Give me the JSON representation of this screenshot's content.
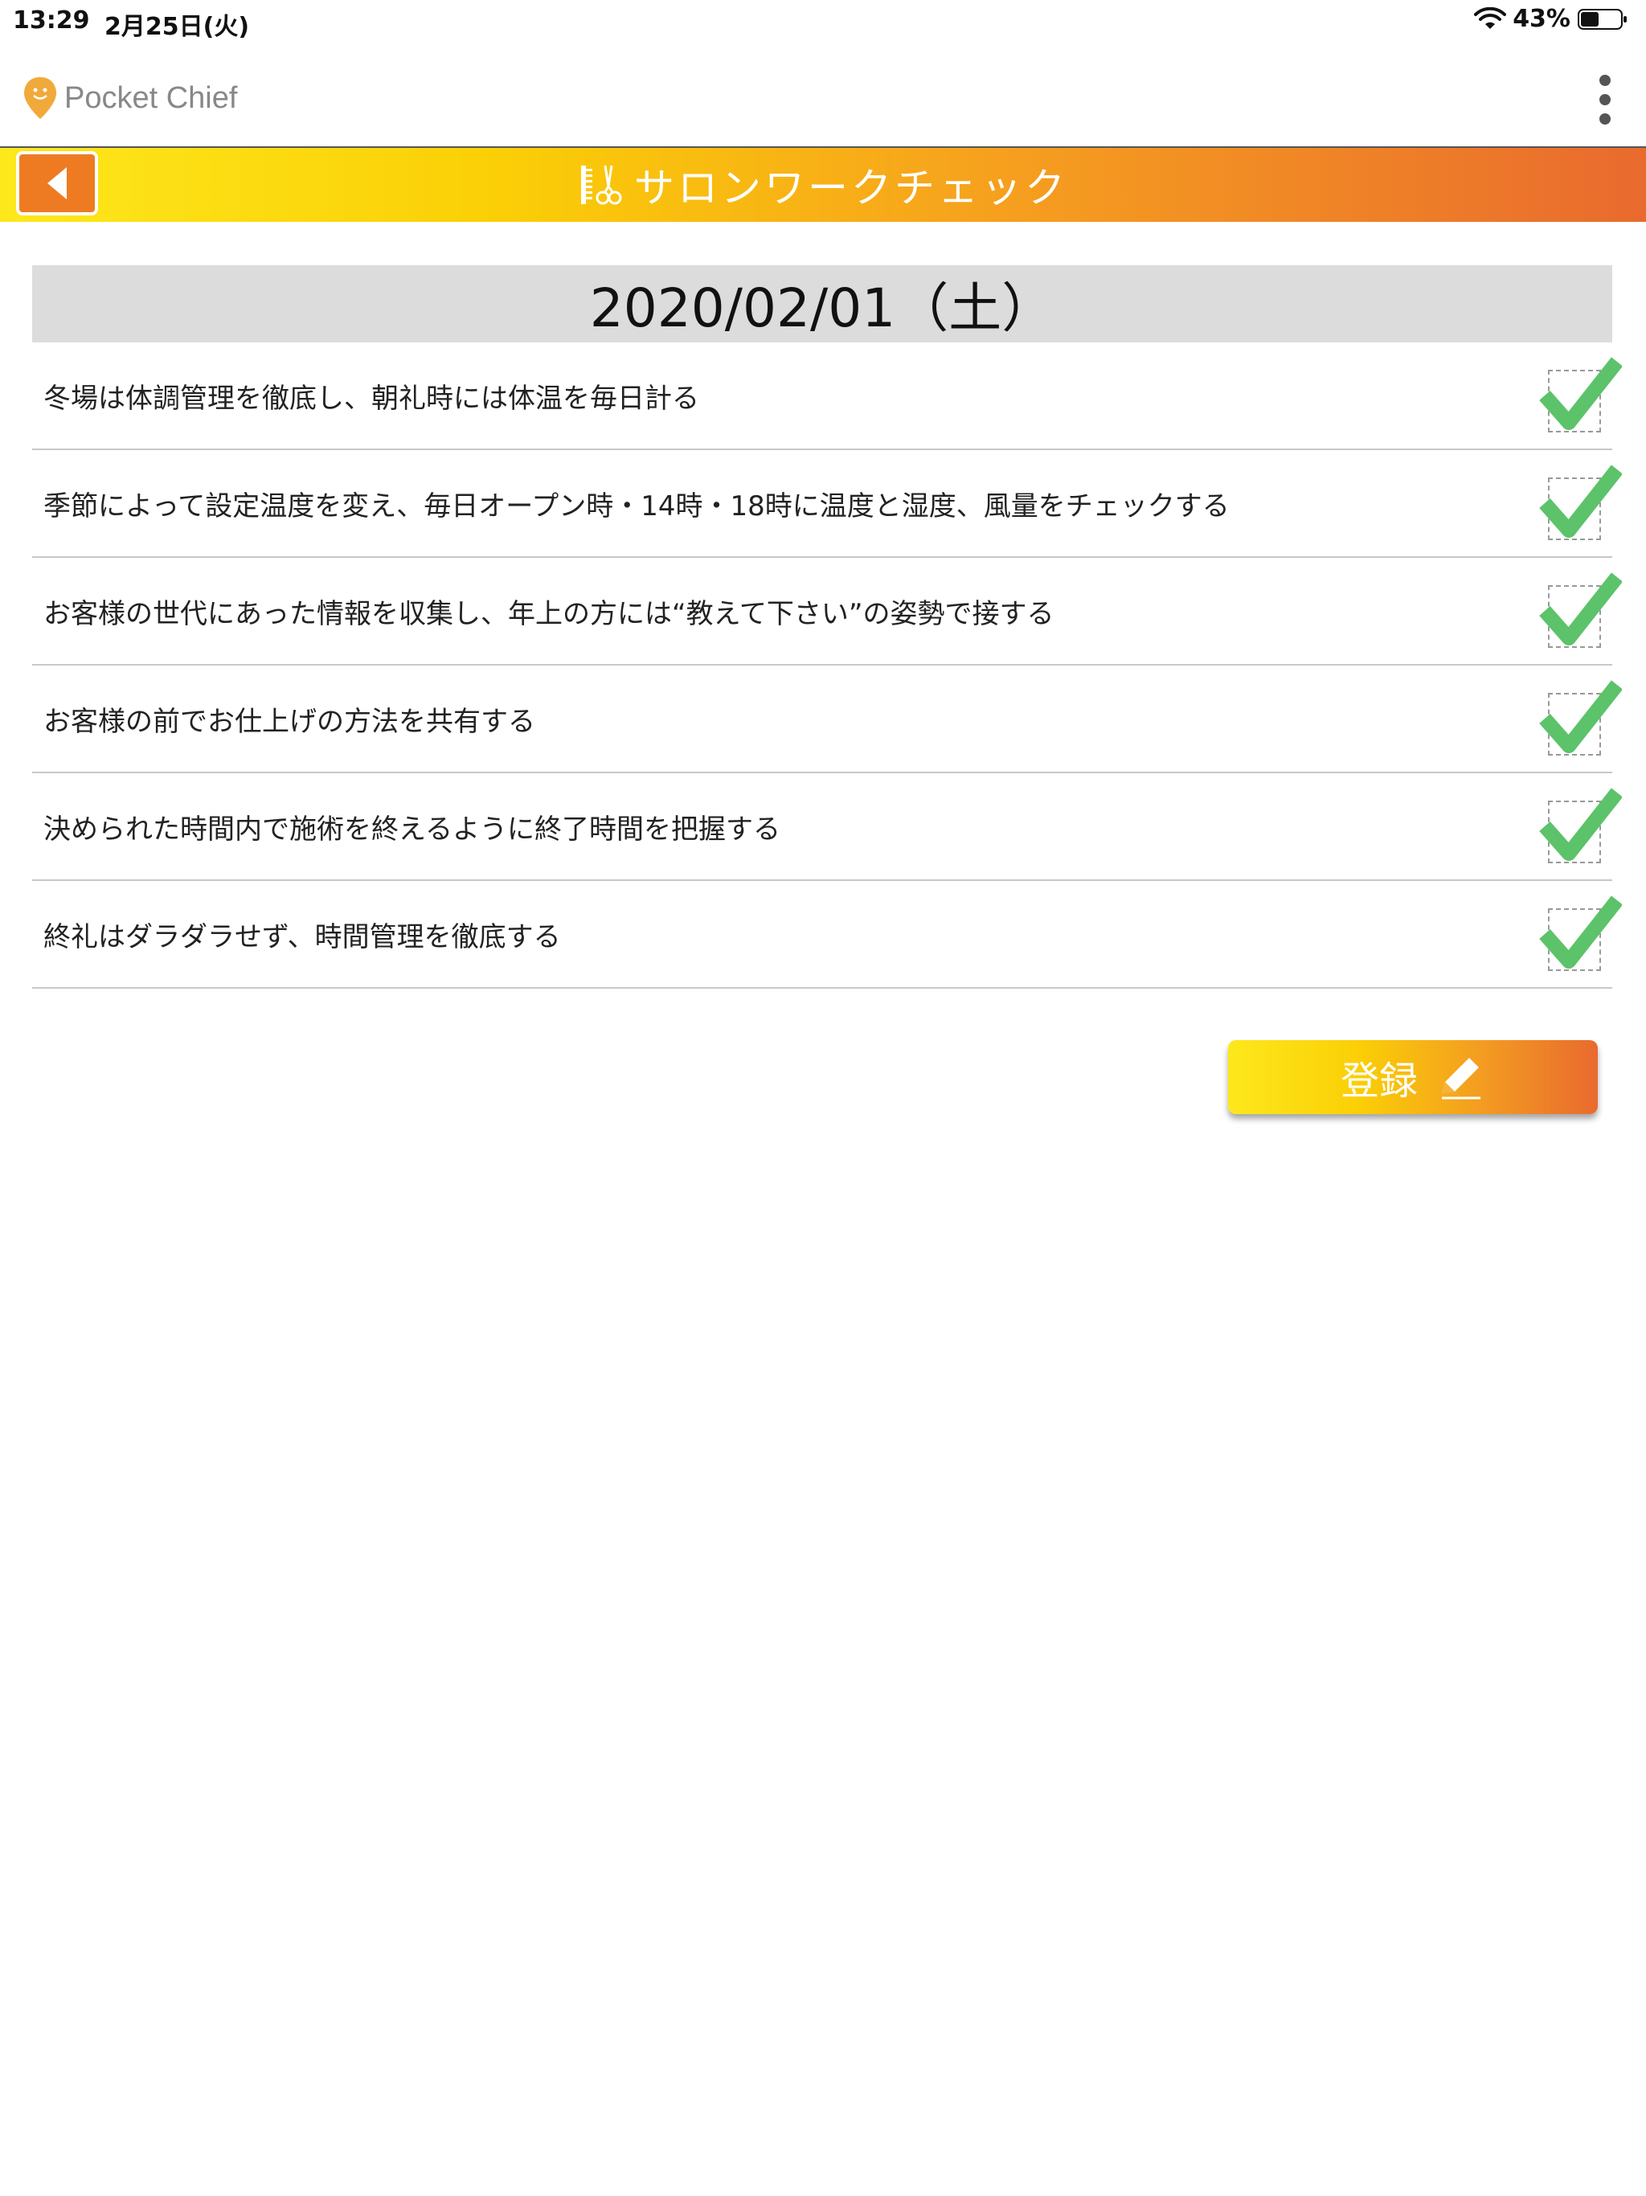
{
  "status_bar": {
    "time": "13:29",
    "date": "2月25日(火)",
    "battery": "43%"
  },
  "app": {
    "logo_text": "Pocket Chief"
  },
  "title_bar": {
    "title": "サロンワークチェック"
  },
  "date_header": "2020/02/01（土）",
  "checklist": {
    "items": [
      {
        "text": "冬場は体調管理を徹底し、朝礼時には体温を毎日計る",
        "checked": true
      },
      {
        "text": "季節によって設定温度を変え、毎日オープン時・14時・18時に温度と湿度、風量をチェックする",
        "checked": true
      },
      {
        "text": "お客様の世代にあった情報を収集し、年上の方には“教えて下さい”の姿勢で接する",
        "checked": true
      },
      {
        "text": "お客様の前でお仕上げの方法を共有する",
        "checked": true
      },
      {
        "text": "決められた時間内で施術を終えるように終了時間を把握する",
        "checked": true
      },
      {
        "text": "終礼はダラダラせず、時間管理を徹底する",
        "checked": true
      }
    ]
  },
  "actions": {
    "register_label": "登録"
  },
  "colors": {
    "accent_orange": "#ee7b22",
    "gradient_yellow": "#fde81c",
    "gradient_red": "#e96a2e",
    "check_green": "#5cc36a",
    "date_bg": "#dcdcdc"
  },
  "icons": {
    "back": "arrow-left-icon",
    "title": "scissors-comb-icon",
    "check": "checkmark-icon",
    "register": "pencil-icon",
    "more": "more-vertical-icon"
  }
}
